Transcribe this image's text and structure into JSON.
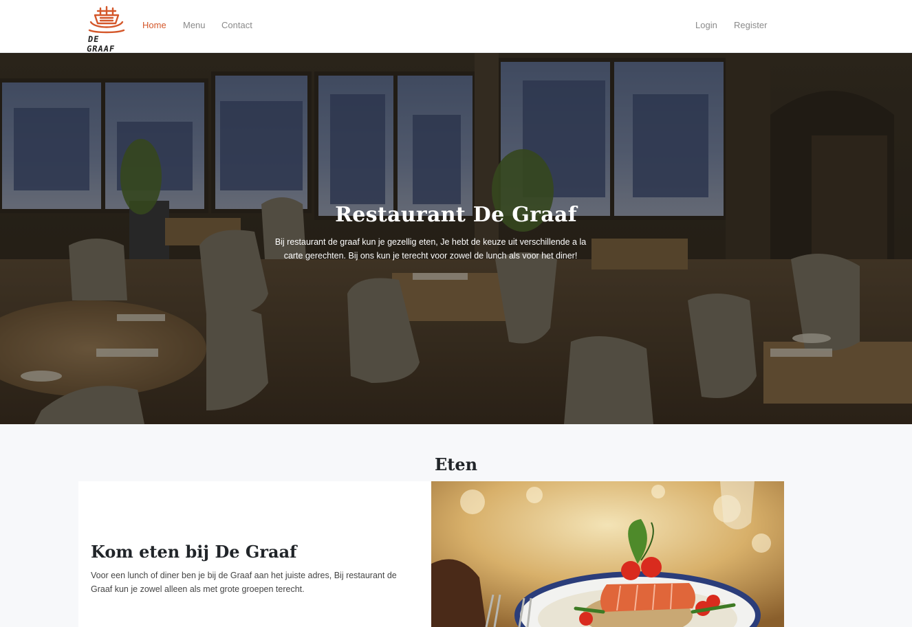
{
  "navbar": {
    "logo_text": "DE GRAAF",
    "links": [
      {
        "label": "Home",
        "active": true
      },
      {
        "label": "Menu",
        "active": false
      },
      {
        "label": "Contact",
        "active": false
      }
    ],
    "login_label": "Login",
    "register_label": "Register"
  },
  "hero": {
    "title": "Restaurant De Graaf",
    "text": "Bij restaurant de graaf kun je gezellig eten, Je hebt de keuze uit verschillende a la carte gerechten. Bij ons kun je terecht voor zowel de lunch als voor het diner!"
  },
  "section": {
    "title": "Eten",
    "card_title": "Kom eten bij De Graaf",
    "card_text": "Voor een lunch of diner ben je bij de Graaf aan het juiste adres, Bij restaurant de Graaf kun je zowel alleen als met grote groepen terecht."
  },
  "colors": {
    "accent": "#d4572a",
    "nav_text": "#8a8a8a",
    "page_bg": "#f7f8fa"
  },
  "icons": {
    "logo": "ship-logo-icon"
  }
}
